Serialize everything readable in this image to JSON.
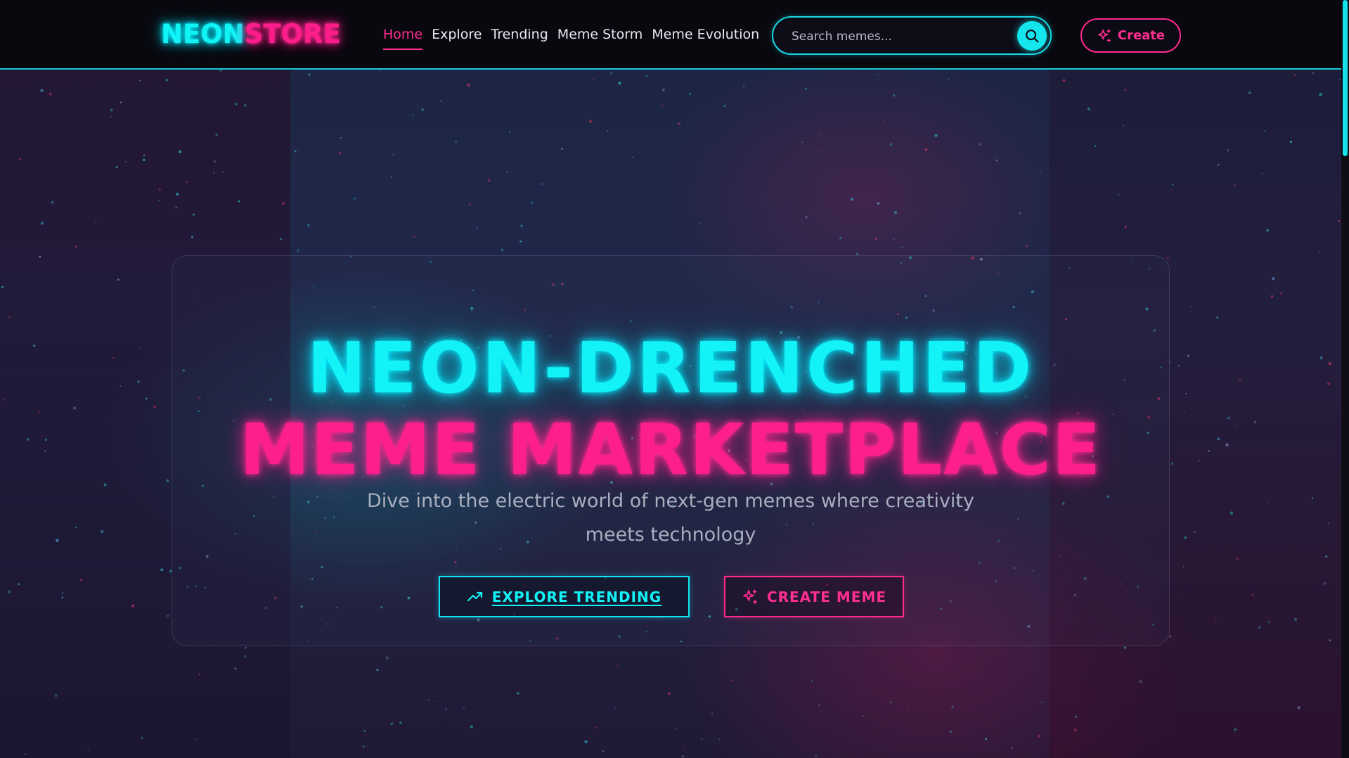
{
  "brand": {
    "part1": "NEON",
    "part2": "STORE"
  },
  "nav": {
    "items": [
      {
        "label": "Home",
        "active": true
      },
      {
        "label": "Explore",
        "active": false
      },
      {
        "label": "Trending",
        "active": false
      },
      {
        "label": "Meme Storm",
        "active": false
      },
      {
        "label": "Meme Evolution",
        "active": false
      }
    ]
  },
  "search": {
    "placeholder": "Search memes...",
    "icon": "search-icon"
  },
  "header_actions": {
    "create_label": "Create",
    "create_icon": "sparkles-icon"
  },
  "hero": {
    "title_line1": "NEON-DRENCHED",
    "title_line2": "MEME MARKETPLACE",
    "subtitle_line1": "Dive into the electric world of next-gen memes where creativity",
    "subtitle_line2": "meets technology",
    "primary_cta": {
      "label": "EXPLORE TRENDING",
      "icon": "trending-up-icon"
    },
    "secondary_cta": {
      "label": "CREATE MEME",
      "icon": "sparkles-icon"
    }
  },
  "colors": {
    "cyan": "#13f2f6",
    "magenta": "#ff1f8c",
    "background": "#0b0a12"
  }
}
